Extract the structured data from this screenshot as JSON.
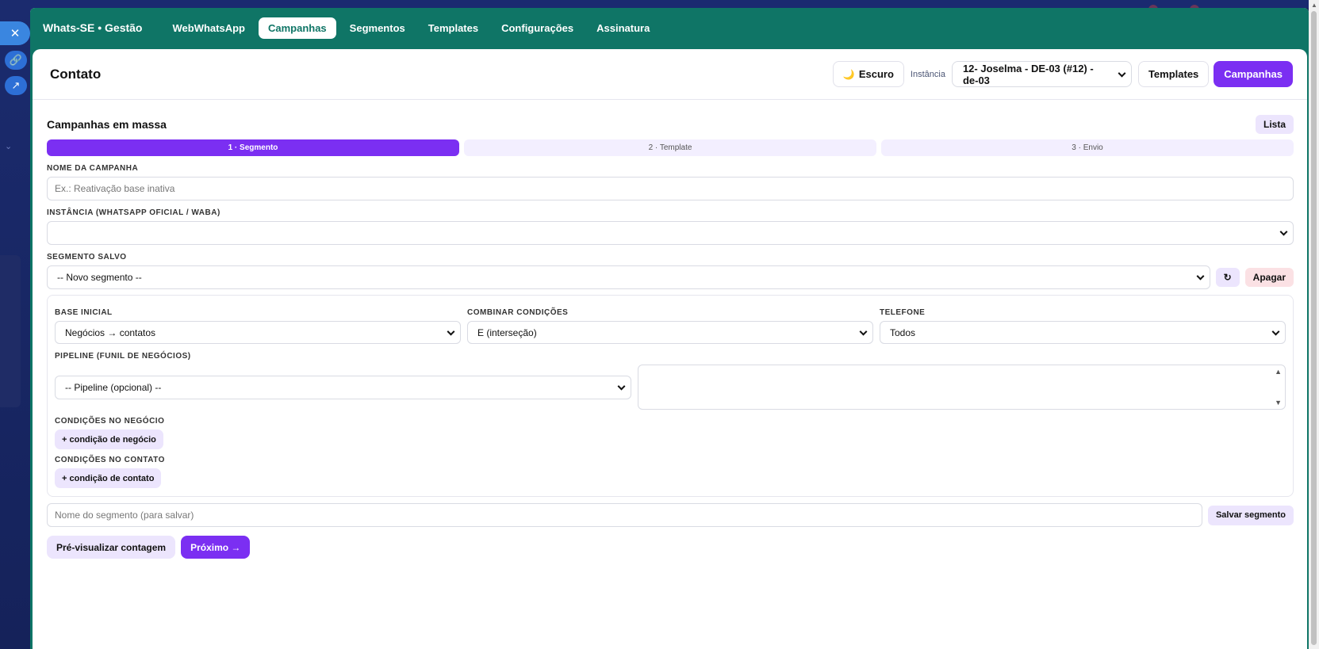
{
  "nav": {
    "brand": "Whats-SE • Gestão",
    "items": [
      {
        "label": "WebWhatsApp",
        "active": false
      },
      {
        "label": "Campanhas",
        "active": true
      },
      {
        "label": "Segmentos",
        "active": false
      },
      {
        "label": "Templates",
        "active": false
      },
      {
        "label": "Configurações",
        "active": false
      },
      {
        "label": "Assinatura",
        "active": false
      }
    ]
  },
  "header": {
    "title": "Contato",
    "theme_label": "Escuro",
    "instance_label": "Instância",
    "instance_value": "12- Joselma - DE-03 (#12) - de-03",
    "templates_button": "Templates",
    "campaigns_button": "Campanhas"
  },
  "campaign": {
    "section_title": "Campanhas em massa",
    "list_button": "Lista",
    "steps": [
      "1 · Segmento",
      "2 · Template",
      "3 · Envio"
    ],
    "active_step": 0,
    "name_label": "NOME DA CAMPANHA",
    "name_placeholder": "Ex.: Reativação base inativa",
    "instance_label": "INSTÂNCIA (WHATSAPP OFICIAL / WABA)",
    "instance_value": "",
    "saved_segment_label": "SEGMENTO SALVO",
    "saved_segment_value": "-- Novo segmento --",
    "refresh_icon": "↻",
    "delete_button": "Apagar"
  },
  "filters": {
    "base_label": "BASE INICIAL",
    "base_value": "Negócios → contatos",
    "combine_label": "COMBINAR CONDIÇÕES",
    "combine_value": "E (interseção)",
    "phone_label": "TELEFONE",
    "phone_value": "Todos",
    "pipeline_label": "PIPELINE (FUNIL DE NEGÓCIOS)",
    "pipeline_value": "-- Pipeline (opcional) --",
    "deal_conditions_label": "CONDIÇÕES NO NEGÓCIO",
    "add_deal_condition": "+ condição de negócio",
    "contact_conditions_label": "CONDIÇÕES NO CONTATO",
    "add_contact_condition": "+ condição de contato"
  },
  "save": {
    "segment_name_placeholder": "Nome do segmento (para salvar)",
    "save_button": "Salvar segmento"
  },
  "actions": {
    "preview_button": "Pré-visualizar contagem",
    "next_button": "Próximo →"
  },
  "colors": {
    "navbar": "#0f7566",
    "primary": "#7b2ff2",
    "soft": "#ece5fd",
    "danger_soft": "#fbe1e4"
  }
}
